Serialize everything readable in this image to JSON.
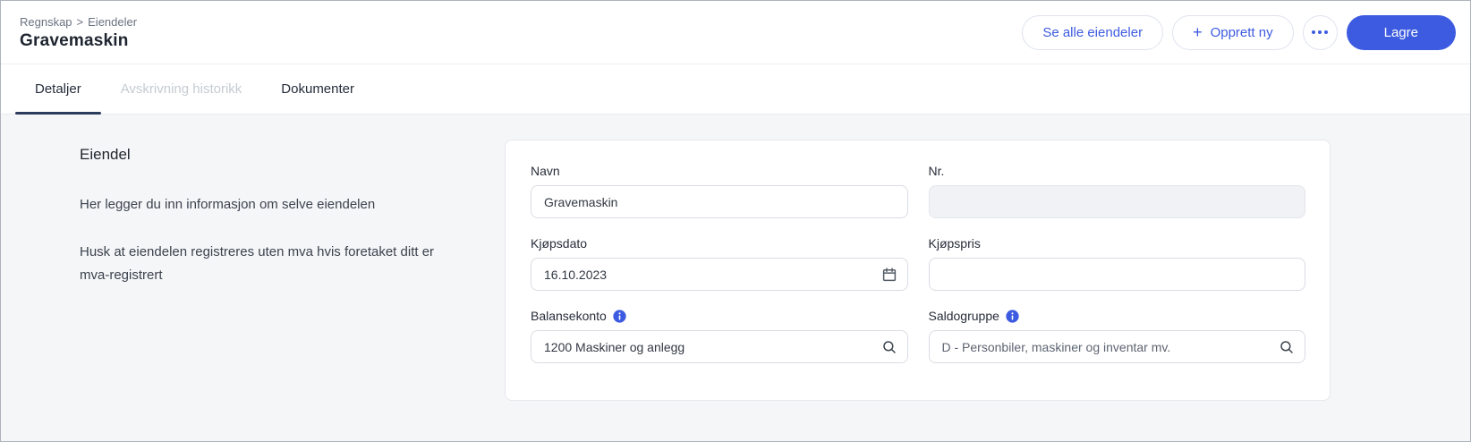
{
  "colors": {
    "primary": "#3d5be0",
    "tab_underline": "#2d3c5c"
  },
  "header": {
    "breadcrumb": {
      "items": [
        "Regnskap",
        "Eiendeler"
      ],
      "separator": ">"
    },
    "title": "Gravemaskin",
    "actions": {
      "see_all": "Se alle eiendeler",
      "create_new": "Opprett ny",
      "create_new_icon": "+",
      "save": "Lagre"
    }
  },
  "tabs": {
    "items": [
      {
        "label": "Detaljer",
        "state": "active"
      },
      {
        "label": "Avskrivning historikk",
        "state": "disabled"
      },
      {
        "label": "Dokumenter",
        "state": "default"
      }
    ]
  },
  "side": {
    "heading": "Eiendel",
    "paragraphs": [
      "Her legger du inn informasjon om selve eiendelen",
      "Husk at eiendelen registreres uten mva hvis foretaket ditt er mva-registrert"
    ]
  },
  "form": {
    "navn": {
      "label": "Navn",
      "value": "Gravemaskin"
    },
    "nr": {
      "label": "Nr.",
      "value": ""
    },
    "kjopsdato": {
      "label": "Kjøpsdato",
      "value": "16.10.2023"
    },
    "kjopspris": {
      "label": "Kjøpspris",
      "value": ""
    },
    "balansekonto": {
      "label": "Balansekonto",
      "value": "1200 Maskiner og anlegg"
    },
    "saldogruppe": {
      "label": "Saldogruppe",
      "value": "D - Personbiler, maskiner og inventar mv."
    }
  }
}
